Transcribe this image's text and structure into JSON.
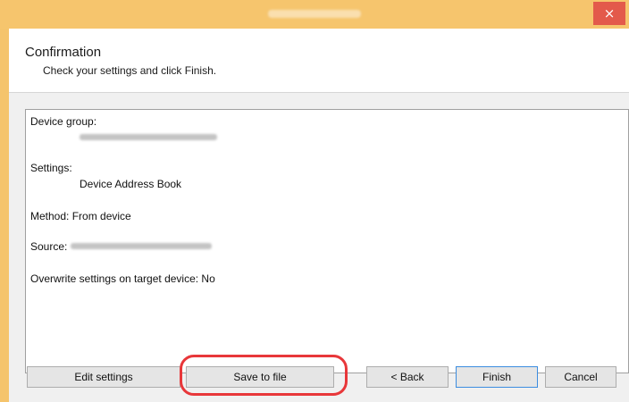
{
  "window": {
    "close_glyph": "×",
    "colors": {
      "frame": "#f5c46c",
      "close": "#e35a4b",
      "highlight": "#e8373a"
    }
  },
  "header": {
    "title": "Confirmation",
    "subtitle": "Check your settings and click Finish."
  },
  "summary": {
    "device_group_label": "Device group:",
    "settings_label": "Settings:",
    "settings_value": "Device Address Book",
    "method_line": "Method: From device",
    "source_label": "Source:",
    "overwrite_line": "Overwrite settings on target device: No"
  },
  "buttons": {
    "edit_settings": "Edit settings",
    "save_to_file": "Save to file",
    "back": "< Back",
    "finish": "Finish",
    "cancel": "Cancel"
  }
}
